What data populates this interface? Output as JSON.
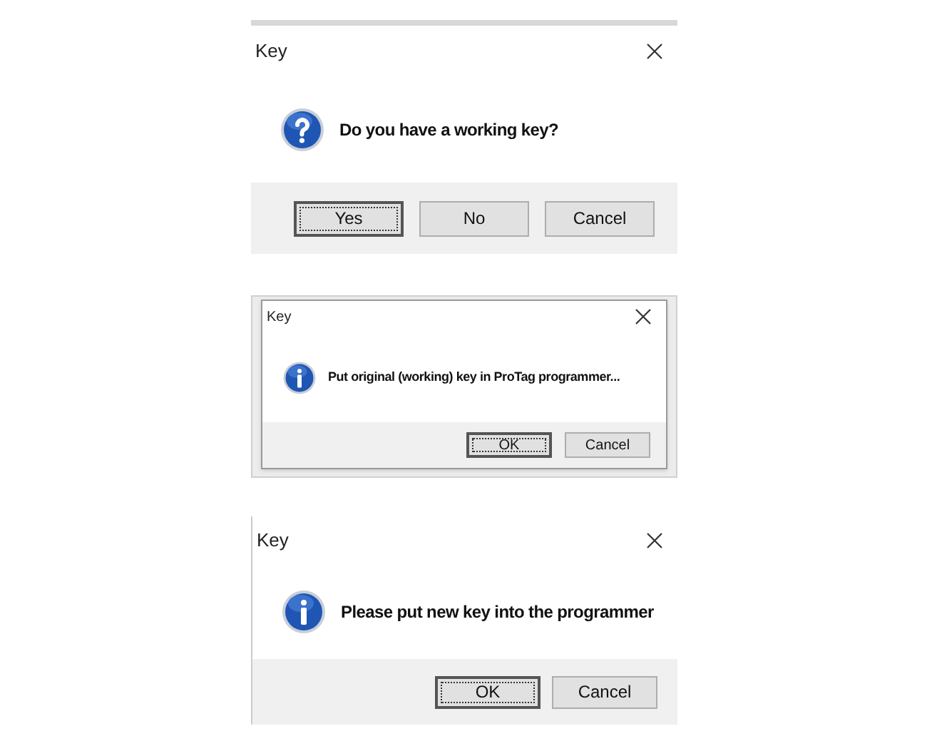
{
  "dialogs": [
    {
      "title": "Key",
      "kind": "question",
      "message": "Do you have a working key?",
      "buttons": [
        {
          "label": "Yes",
          "default": true
        },
        {
          "label": "No",
          "default": false
        },
        {
          "label": "Cancel",
          "default": false
        }
      ]
    },
    {
      "title": "Key",
      "kind": "info",
      "message": "Put original (working) key in ProTag programmer...",
      "buttons": [
        {
          "label": "OK",
          "default": true
        },
        {
          "label": "Cancel",
          "default": false
        }
      ]
    },
    {
      "title": "Key",
      "kind": "info",
      "message": "Please put new key into the programmer",
      "buttons": [
        {
          "label": "OK",
          "default": true
        },
        {
          "label": "Cancel",
          "default": false
        }
      ]
    }
  ]
}
